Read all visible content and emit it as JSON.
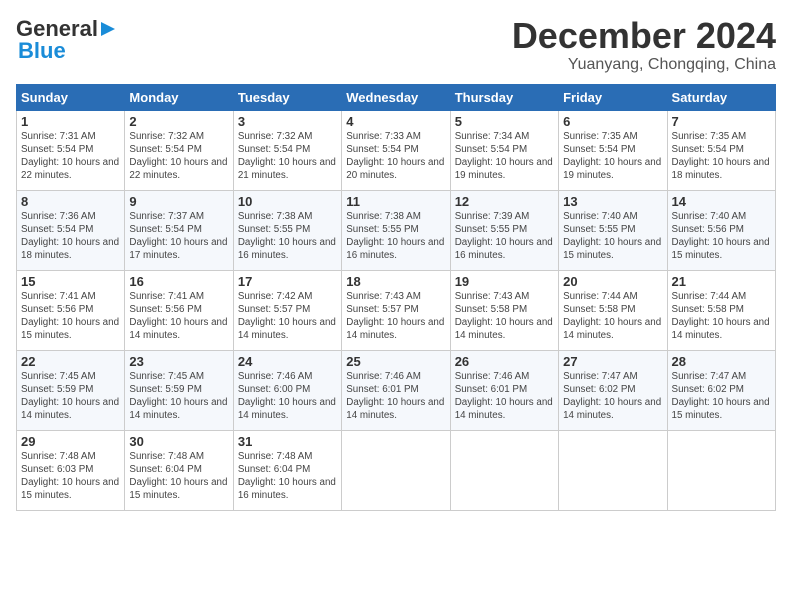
{
  "logo": {
    "general": "General",
    "blue": "Blue"
  },
  "title": "December 2024",
  "subtitle": "Yuanyang, Chongqing, China",
  "days_of_week": [
    "Sunday",
    "Monday",
    "Tuesday",
    "Wednesday",
    "Thursday",
    "Friday",
    "Saturday"
  ],
  "weeks": [
    [
      {
        "day": "1",
        "info": "Sunrise: 7:31 AM\nSunset: 5:54 PM\nDaylight: 10 hours\nand 22 minutes."
      },
      {
        "day": "2",
        "info": "Sunrise: 7:32 AM\nSunset: 5:54 PM\nDaylight: 10 hours\nand 22 minutes."
      },
      {
        "day": "3",
        "info": "Sunrise: 7:32 AM\nSunset: 5:54 PM\nDaylight: 10 hours\nand 21 minutes."
      },
      {
        "day": "4",
        "info": "Sunrise: 7:33 AM\nSunset: 5:54 PM\nDaylight: 10 hours\nand 20 minutes."
      },
      {
        "day": "5",
        "info": "Sunrise: 7:34 AM\nSunset: 5:54 PM\nDaylight: 10 hours\nand 19 minutes."
      },
      {
        "day": "6",
        "info": "Sunrise: 7:35 AM\nSunset: 5:54 PM\nDaylight: 10 hours\nand 19 minutes."
      },
      {
        "day": "7",
        "info": "Sunrise: 7:35 AM\nSunset: 5:54 PM\nDaylight: 10 hours\nand 18 minutes."
      }
    ],
    [
      {
        "day": "8",
        "info": "Sunrise: 7:36 AM\nSunset: 5:54 PM\nDaylight: 10 hours\nand 18 minutes."
      },
      {
        "day": "9",
        "info": "Sunrise: 7:37 AM\nSunset: 5:54 PM\nDaylight: 10 hours\nand 17 minutes."
      },
      {
        "day": "10",
        "info": "Sunrise: 7:38 AM\nSunset: 5:55 PM\nDaylight: 10 hours\nand 16 minutes."
      },
      {
        "day": "11",
        "info": "Sunrise: 7:38 AM\nSunset: 5:55 PM\nDaylight: 10 hours\nand 16 minutes."
      },
      {
        "day": "12",
        "info": "Sunrise: 7:39 AM\nSunset: 5:55 PM\nDaylight: 10 hours\nand 16 minutes."
      },
      {
        "day": "13",
        "info": "Sunrise: 7:40 AM\nSunset: 5:55 PM\nDaylight: 10 hours\nand 15 minutes."
      },
      {
        "day": "14",
        "info": "Sunrise: 7:40 AM\nSunset: 5:56 PM\nDaylight: 10 hours\nand 15 minutes."
      }
    ],
    [
      {
        "day": "15",
        "info": "Sunrise: 7:41 AM\nSunset: 5:56 PM\nDaylight: 10 hours\nand 15 minutes."
      },
      {
        "day": "16",
        "info": "Sunrise: 7:41 AM\nSunset: 5:56 PM\nDaylight: 10 hours\nand 14 minutes."
      },
      {
        "day": "17",
        "info": "Sunrise: 7:42 AM\nSunset: 5:57 PM\nDaylight: 10 hours\nand 14 minutes."
      },
      {
        "day": "18",
        "info": "Sunrise: 7:43 AM\nSunset: 5:57 PM\nDaylight: 10 hours\nand 14 minutes."
      },
      {
        "day": "19",
        "info": "Sunrise: 7:43 AM\nSunset: 5:58 PM\nDaylight: 10 hours\nand 14 minutes."
      },
      {
        "day": "20",
        "info": "Sunrise: 7:44 AM\nSunset: 5:58 PM\nDaylight: 10 hours\nand 14 minutes."
      },
      {
        "day": "21",
        "info": "Sunrise: 7:44 AM\nSunset: 5:58 PM\nDaylight: 10 hours\nand 14 minutes."
      }
    ],
    [
      {
        "day": "22",
        "info": "Sunrise: 7:45 AM\nSunset: 5:59 PM\nDaylight: 10 hours\nand 14 minutes."
      },
      {
        "day": "23",
        "info": "Sunrise: 7:45 AM\nSunset: 5:59 PM\nDaylight: 10 hours\nand 14 minutes."
      },
      {
        "day": "24",
        "info": "Sunrise: 7:46 AM\nSunset: 6:00 PM\nDaylight: 10 hours\nand 14 minutes."
      },
      {
        "day": "25",
        "info": "Sunrise: 7:46 AM\nSunset: 6:01 PM\nDaylight: 10 hours\nand 14 minutes."
      },
      {
        "day": "26",
        "info": "Sunrise: 7:46 AM\nSunset: 6:01 PM\nDaylight: 10 hours\nand 14 minutes."
      },
      {
        "day": "27",
        "info": "Sunrise: 7:47 AM\nSunset: 6:02 PM\nDaylight: 10 hours\nand 14 minutes."
      },
      {
        "day": "28",
        "info": "Sunrise: 7:47 AM\nSunset: 6:02 PM\nDaylight: 10 hours\nand 15 minutes."
      }
    ],
    [
      {
        "day": "29",
        "info": "Sunrise: 7:48 AM\nSunset: 6:03 PM\nDaylight: 10 hours\nand 15 minutes."
      },
      {
        "day": "30",
        "info": "Sunrise: 7:48 AM\nSunset: 6:04 PM\nDaylight: 10 hours\nand 15 minutes."
      },
      {
        "day": "31",
        "info": "Sunrise: 7:48 AM\nSunset: 6:04 PM\nDaylight: 10 hours\nand 16 minutes."
      },
      {
        "day": "",
        "info": ""
      },
      {
        "day": "",
        "info": ""
      },
      {
        "day": "",
        "info": ""
      },
      {
        "day": "",
        "info": ""
      }
    ]
  ]
}
